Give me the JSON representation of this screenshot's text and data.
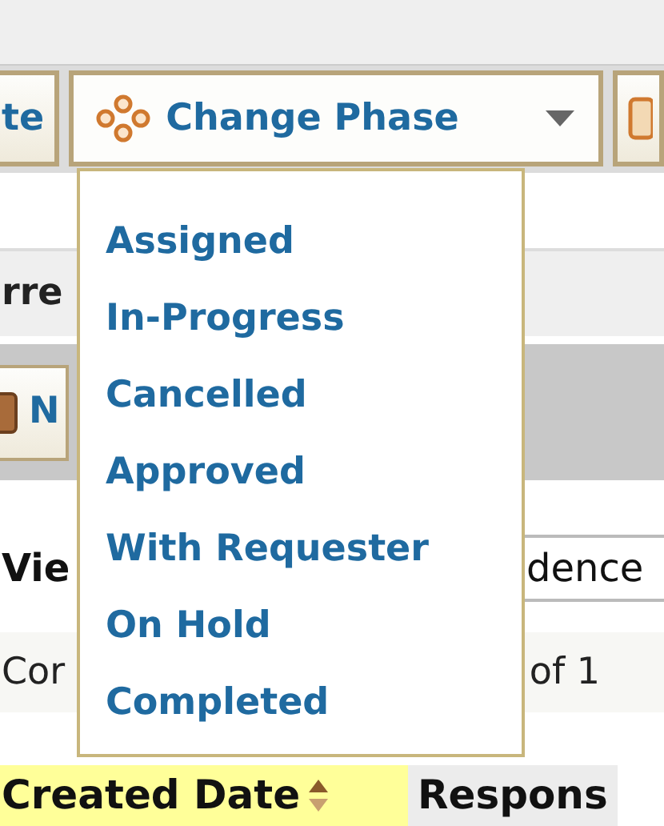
{
  "toolbar": [
    {
      "kind": "text",
      "label": "te"
    },
    {
      "kind": "dropdown",
      "label": "Change Phase",
      "expanded": true
    },
    {
      "kind": "icon"
    }
  ],
  "phase_menu": [
    "Assigned",
    "In-Progress",
    "Cancelled",
    "Approved",
    "With Requester",
    "On Hold",
    "Completed"
  ],
  "section_label": "rre",
  "new_button": {
    "label": "N"
  },
  "view_label": "Vie",
  "view_field": {
    "value": "dence"
  },
  "count_label": "Cor",
  "page_info": "of 1",
  "table": {
    "columns": [
      {
        "label": "Created Date",
        "sorted": true
      },
      {
        "label": "Respons",
        "sorted": false
      }
    ]
  }
}
